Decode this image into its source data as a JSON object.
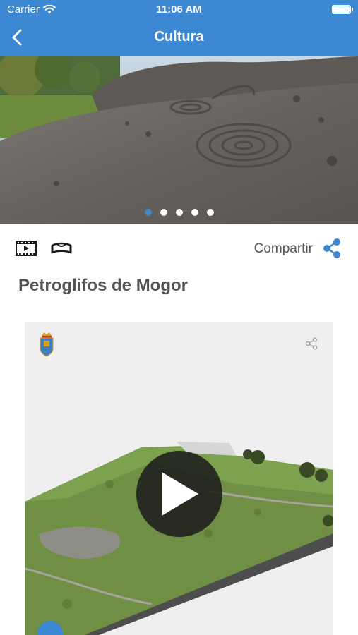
{
  "status_bar": {
    "carrier": "Carrier",
    "time": "11:06 AM"
  },
  "nav": {
    "title": "Cultura",
    "back_icon": "chevron-left-icon"
  },
  "hero": {
    "slide_count": 5,
    "active_slide": 1
  },
  "toolbar": {
    "video_icon": "film-icon",
    "panorama_icon": "panorama-360-icon",
    "share_label": "Compartir",
    "share_icon": "share-icon"
  },
  "place": {
    "title": "Petroglifos de Mogor"
  },
  "viewer": {
    "crest_icon": "coat-of-arms-icon",
    "share_icon": "share-icon",
    "play_icon": "play-icon"
  },
  "colors": {
    "accent": "#3d88d2",
    "title_text": "#545454",
    "label_text": "#555555"
  }
}
